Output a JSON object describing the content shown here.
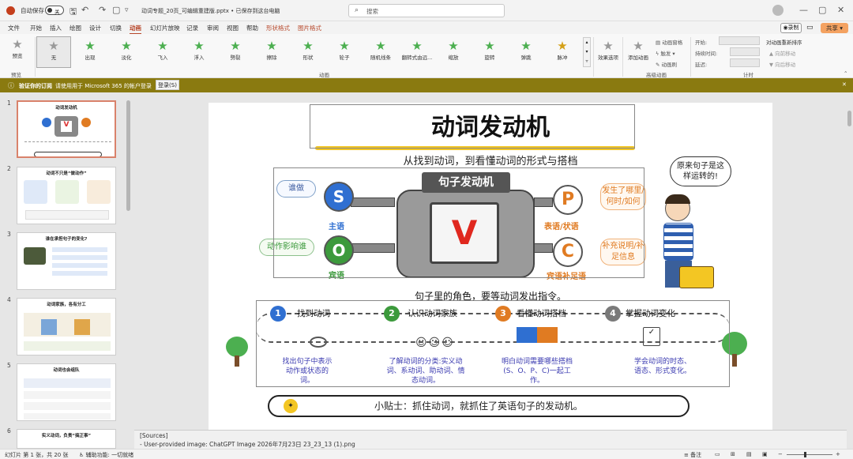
{
  "titlebar": {
    "autosave_label": "自动保存",
    "autosave_state": "关",
    "file_name": "动词专题_20页_可编辑重建版.pptx • 已保存到这台电脑",
    "search_placeholder": "搜索"
  },
  "menu": [
    "文件",
    "开始",
    "插入",
    "绘图",
    "设计",
    "切换",
    "动画",
    "幻灯片放映",
    "记录",
    "审阅",
    "视图",
    "帮助",
    "形状格式",
    "图片格式"
  ],
  "menu_active": "动画",
  "record_label": "录制",
  "share_label": "共享",
  "ribbon": {
    "preview_label": "预览",
    "preview_group": "预览",
    "animations": [
      "无",
      "出现",
      "淡化",
      "飞入",
      "浮入",
      "劈裂",
      "擦除",
      "形状",
      "轮子",
      "随机线条",
      "翻转式由远...",
      "缩放",
      "旋转",
      "弹跳",
      "脉冲"
    ],
    "animation_group": "动画",
    "effect_options": "效果选项",
    "add_animation": "添加动画",
    "animation_pane": "动画窗格",
    "trigger": "触发",
    "animation_painter": "动画刷",
    "advanced_group": "高级动画",
    "start_label": "开始:",
    "duration_label": "持续时间:",
    "delay_label": "延迟:",
    "reorder_title": "对动画重新排序",
    "move_earlier": "向前移动",
    "move_later": "向后移动",
    "timing_group": "计时"
  },
  "message_bar": {
    "bold_text": "验证你的订阅",
    "text": "请使用用于 Microsoft 365 的帐户登录",
    "button": "登录(S)"
  },
  "thumbnails": [
    {
      "num": "1",
      "title": "动词发动机"
    },
    {
      "num": "2",
      "title": "动词不只是“做动作”"
    },
    {
      "num": "3",
      "title": "谁在承担句子的变化?"
    },
    {
      "num": "4",
      "title": "动词家族，各有分工"
    },
    {
      "num": "5",
      "title": "动词也会组队"
    },
    {
      "num": "6",
      "title": "实义动词，负责“搞正事”"
    }
  ],
  "slide": {
    "title": "动词发动机",
    "subtitle": "从找到动词，到看懂动词的形式与搭档",
    "engine_label": "句子发动机",
    "letters": {
      "s": "S",
      "o": "O",
      "p": "P",
      "c": "C",
      "v": "V"
    },
    "labels": {
      "subject": "主语",
      "object": "宾语",
      "predicative": "表语/状语",
      "complement": "宾语补足语",
      "who": "谁做",
      "action_object": "动作影响谁",
      "what_when": "发生了哪里/何时/如何",
      "supplement": "补充说明/补足信息"
    },
    "bubble": "原来句子是这样运转的!",
    "caption": "句子里的角色，要等动词发出指令。",
    "steps": [
      {
        "num": "1",
        "label": "找到动词",
        "desc": "找出句子中表示动作或状态的词。",
        "color": "#2f6fd1"
      },
      {
        "num": "2",
        "label": "认识动词家族",
        "desc": "了解动词的分类:实义动词、系动词、助动词、情态动词。",
        "color": "#3c9a3c"
      },
      {
        "num": "3",
        "label": "看懂动词搭档",
        "desc": "明白动词需要哪些搭档(S、O、P、C)一起工作。",
        "color": "#e07b22"
      },
      {
        "num": "4",
        "label": "掌握动词变化",
        "desc": "学会动词的时态、语态、形式变化。",
        "color": "#7a7a7a"
      }
    ],
    "tip": "小贴士：抓住动词，就抓住了英语句子的发动机。"
  },
  "notes": {
    "header": "[Sources]",
    "line": "- User-provided image: ChatGPT Image 2026年7月23日 23_23_13 (1).png"
  },
  "status": {
    "slide_info": "幻灯片 第 1 张，共 20 张",
    "accessibility": "辅助功能: 一切就绪",
    "notes_label": "备注"
  },
  "colors": {
    "accent": "#b7472a",
    "message_bar": "#8a7a10",
    "share": "#f4a261"
  }
}
